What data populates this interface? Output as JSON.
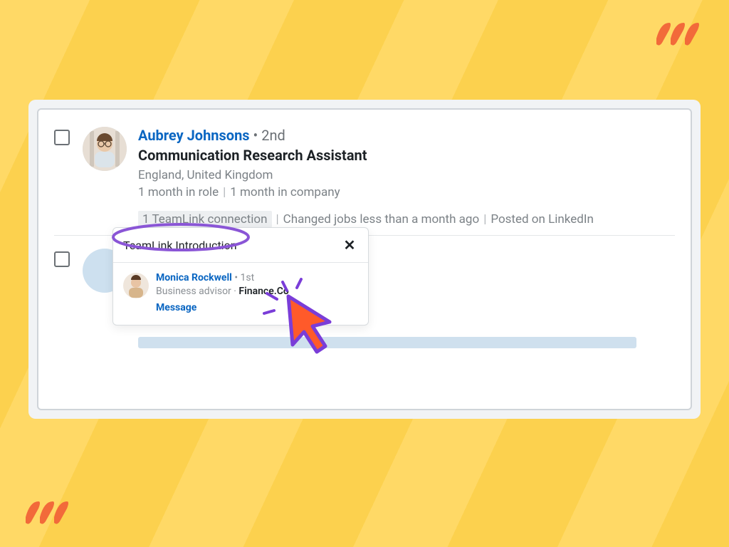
{
  "result1": {
    "name": "Aubrey Johnsons",
    "degree_separator": " • ",
    "degree": "2nd",
    "title": "Communication Research Assistant",
    "location": "England, United Kingdom",
    "tenure_role": "1 month in role",
    "tenure_company": "1 month in company",
    "signals": {
      "teamlink": "1 TeamLink connection",
      "jobchange": "Changed jobs less than a month ago",
      "posted": "Posted on LinkedIn"
    }
  },
  "popover": {
    "title": "TeamLink Introduction",
    "close_label": "✕",
    "contact": {
      "name": "Monica Rockwell",
      "degree_separator": " • ",
      "degree": "1st",
      "role": "Business advisor",
      "sub_separator": " · ",
      "company": "Finance.Co",
      "message_label": "Message"
    }
  },
  "colors": {
    "link": "#0a66c2",
    "accent": "#ff5a2a",
    "annotation": "#7a3dd8"
  }
}
